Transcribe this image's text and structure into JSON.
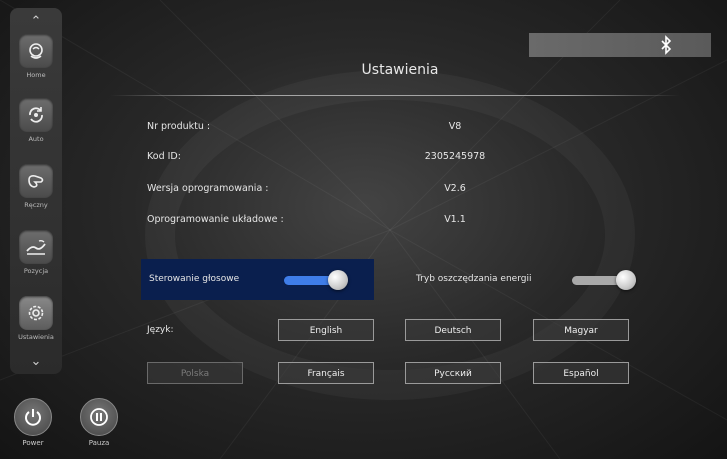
{
  "title": "Ustawienia",
  "sidebar": {
    "items": [
      {
        "label": "Home",
        "icon": "home-swirl-icon"
      },
      {
        "label": "Auto",
        "icon": "auto-cycle-icon"
      },
      {
        "label": "Ręczny",
        "icon": "hand-icon"
      },
      {
        "label": "Pozycja",
        "icon": "recline-position-icon"
      },
      {
        "label": "Ustawienia",
        "icon": "gear-icon"
      }
    ],
    "active": "Ustawienia"
  },
  "bottom": {
    "power_label": "Power",
    "pause_label": "Pauza"
  },
  "info": [
    {
      "label": "Nr produktu :",
      "value": "V8"
    },
    {
      "label": "Kod ID:",
      "value": "2305245978"
    },
    {
      "label": "Wersja oprogramowania :",
      "value": "V2.6"
    },
    {
      "label": "Oprogramowanie układowe :",
      "value": "V1.1"
    }
  ],
  "voice_control": {
    "label": "Sterowanie głosowe",
    "on": true
  },
  "energy_saving": {
    "label": "Tryb oszczędzania energii",
    "on": false
  },
  "language": {
    "label": "Język:",
    "options_row1": [
      "English",
      "Deutsch",
      "Magyar"
    ],
    "options_row2": [
      "Polska",
      "Français",
      "Русский",
      "Español"
    ],
    "selected": "Polska"
  },
  "colors": {
    "accent": "#3f7de8",
    "voice_highlight": "#0a1f4e",
    "toggle_off": "#a9a9a9"
  }
}
